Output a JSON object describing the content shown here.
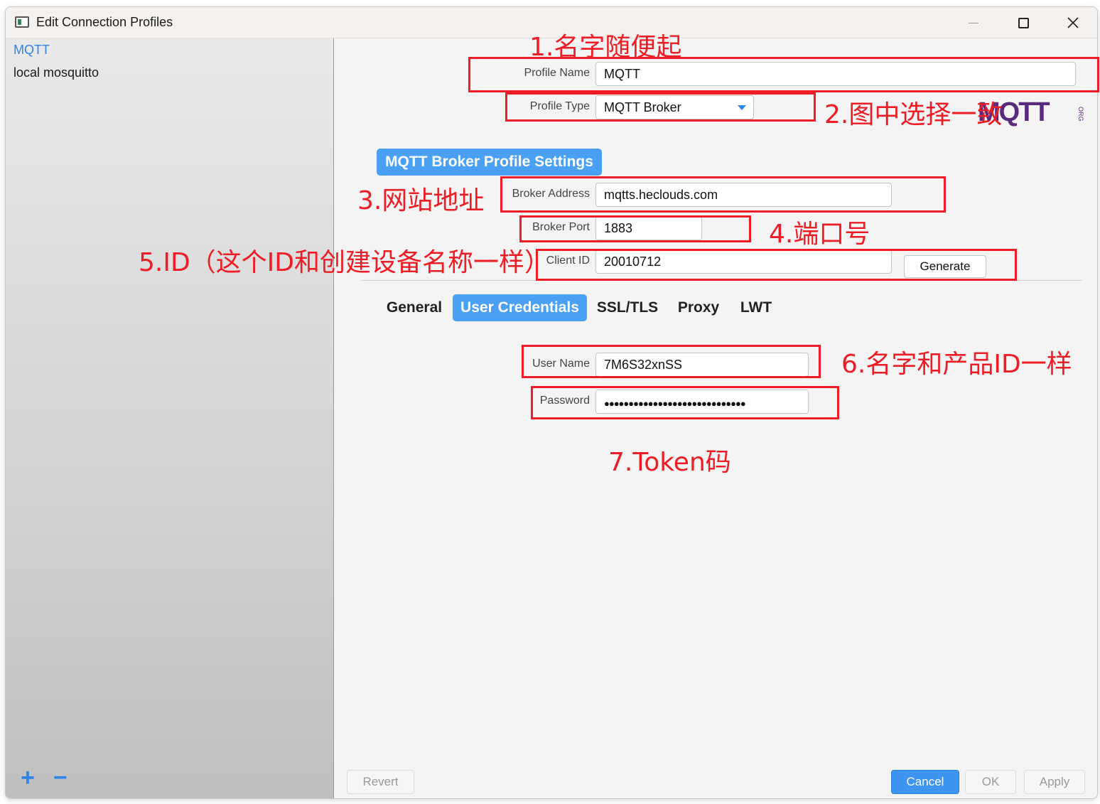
{
  "window": {
    "title": "Edit Connection Profiles"
  },
  "sidebar": {
    "items": [
      {
        "label": "MQTT",
        "selected": true
      },
      {
        "label": "local mosquitto",
        "selected": false
      }
    ],
    "add_label": "+",
    "remove_label": "−"
  },
  "form": {
    "profile_name": {
      "label": "Profile Name",
      "value": "MQTT"
    },
    "profile_type": {
      "label": "Profile Type",
      "value": "MQTT Broker"
    },
    "section_title": "MQTT Broker Profile Settings",
    "broker_address": {
      "label": "Broker Address",
      "value": "mqtts.heclouds.com"
    },
    "broker_port": {
      "label": "Broker Port",
      "value": "1883"
    },
    "client_id": {
      "label": "Client ID",
      "value": "20010712"
    },
    "generate_label": "Generate",
    "tabs": [
      {
        "label": "General",
        "active": false
      },
      {
        "label": "User Credentials",
        "active": true
      },
      {
        "label": "SSL/TLS",
        "active": false
      },
      {
        "label": "Proxy",
        "active": false
      },
      {
        "label": "LWT",
        "active": false
      }
    ],
    "user_name": {
      "label": "User Name",
      "value": "7M6S32xnSS"
    },
    "password": {
      "label": "Password",
      "value": "●●●●●●●●●●●●●●●●●●●●●●●●●●●●●"
    }
  },
  "logo": {
    "text": "MQTT",
    "org": "ORG"
  },
  "footer": {
    "revert_label": "Revert",
    "cancel_label": "Cancel",
    "ok_label": "OK",
    "apply_label": "Apply"
  },
  "annotations": {
    "note1": "1.名字随便起",
    "note2": "2.图中选择一致",
    "note3": "3.网站地址",
    "note4": "4.端口号",
    "note5": "5.ID（这个ID和创建设备名称一样）",
    "note6": "6.名字和产品ID一样",
    "note7": "7.Token码",
    "color": "#ee1c24"
  },
  "colors": {
    "accent": "#4aa0f5",
    "selected_text": "#2f86e8",
    "primary_button": "#3d95f0"
  }
}
